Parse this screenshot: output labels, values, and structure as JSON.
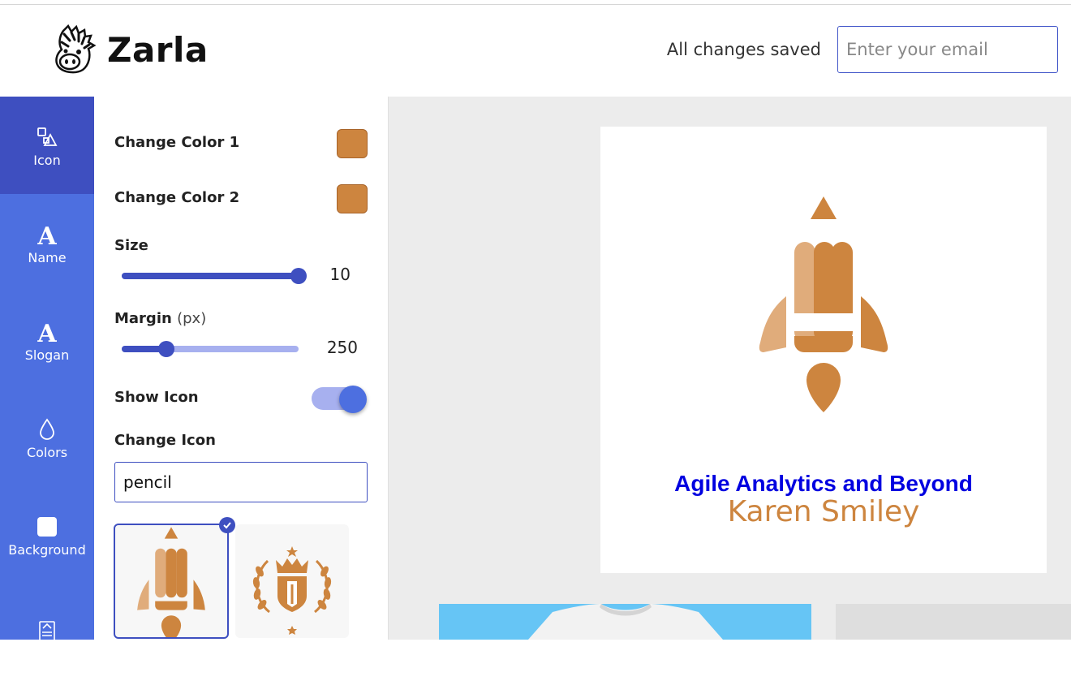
{
  "header": {
    "brand": "Zarla",
    "status": "All changes saved",
    "email_placeholder": "Enter your email"
  },
  "sidebar": {
    "items": [
      {
        "label": "Icon",
        "icon": "shapes-icon",
        "active": true
      },
      {
        "label": "Name",
        "icon": "font-icon"
      },
      {
        "label": "Slogan",
        "icon": "font-icon"
      },
      {
        "label": "Colors",
        "icon": "droplet-icon"
      },
      {
        "label": "Background",
        "icon": "square-icon"
      },
      {
        "label": "",
        "icon": "layout-icon"
      }
    ]
  },
  "panel": {
    "color1_label": "Change Color 1",
    "color1": "#cd853f",
    "color2_label": "Change Color 2",
    "color2": "#cd853f",
    "size_label": "Size",
    "size_value": "10",
    "size_fraction": 1.0,
    "margin_label": "Margin",
    "margin_unit": "(px)",
    "margin_value": "250",
    "margin_fraction": 0.25,
    "show_icon_label": "Show Icon",
    "show_icon": true,
    "change_icon_label": "Change Icon",
    "search_value": "pencil",
    "results": [
      {
        "name": "pencil-rocket-icon",
        "selected": true
      },
      {
        "name": "laurel-crest-icon",
        "selected": false
      }
    ]
  },
  "preview": {
    "name": "Agile Analytics and Beyond",
    "slogan": "Karen Smiley",
    "name_color": "#0000e0",
    "slogan_color": "#cd853f",
    "icon": "pencil-rocket-icon"
  },
  "colors": {
    "accent": "#3e4fc0",
    "rail": "#4d6fe0",
    "icon_dark": "#cd853f",
    "icon_light": "#e0ac7b"
  }
}
